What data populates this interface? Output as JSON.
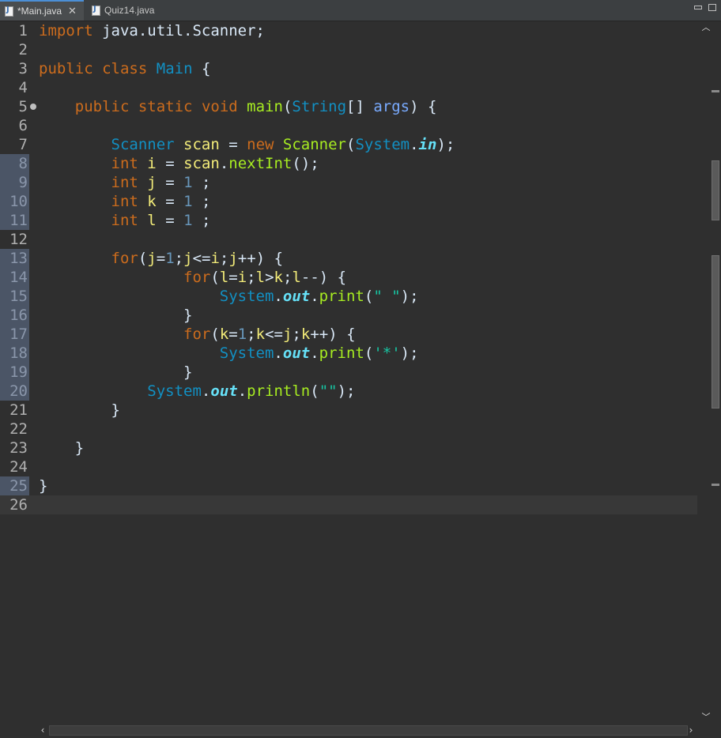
{
  "tabs": [
    {
      "label": "*Main.java",
      "active": true
    },
    {
      "label": "Quiz14.java",
      "active": false
    }
  ],
  "icons": {
    "java_file": "java-file-icon",
    "close": "close-icon",
    "minimize": "minimize-icon",
    "maximize": "maximize-icon"
  },
  "colors": {
    "keyword": "#cc6c1d",
    "type": "#1290c3",
    "method": "#a7ec21",
    "variable": "#f3ec79",
    "number": "#6897bb",
    "string": "#17c6a3",
    "static_field": "#66e1f8",
    "background": "#2f2f2f"
  },
  "lines": [
    {
      "n": "1",
      "mark": false,
      "tokens": [
        [
          "kw",
          "import"
        ],
        [
          "plain",
          " java.util.Scanner;"
        ]
      ]
    },
    {
      "n": "2",
      "mark": false,
      "tokens": []
    },
    {
      "n": "3",
      "mark": false,
      "tokens": [
        [
          "kw",
          "public"
        ],
        [
          "plain",
          " "
        ],
        [
          "kw",
          "class"
        ],
        [
          "plain",
          " "
        ],
        [
          "cls",
          "Main"
        ],
        [
          "plain",
          " {"
        ]
      ]
    },
    {
      "n": "4",
      "mark": false,
      "tokens": []
    },
    {
      "n": "5",
      "mark": false,
      "fold": true,
      "tokens": [
        [
          "plain",
          "    "
        ],
        [
          "kw",
          "public"
        ],
        [
          "plain",
          " "
        ],
        [
          "kw",
          "static"
        ],
        [
          "plain",
          " "
        ],
        [
          "kw",
          "void"
        ],
        [
          "plain",
          " "
        ],
        [
          "fn",
          "main"
        ],
        [
          "plain",
          "("
        ],
        [
          "ty",
          "String"
        ],
        [
          "plain",
          "[] "
        ],
        [
          "arg",
          "args"
        ],
        [
          "plain",
          ") {"
        ]
      ]
    },
    {
      "n": "6",
      "mark": false,
      "tokens": []
    },
    {
      "n": "7",
      "mark": false,
      "tokens": [
        [
          "plain",
          "        "
        ],
        [
          "ty",
          "Scanner"
        ],
        [
          "plain",
          " "
        ],
        [
          "var",
          "scan"
        ],
        [
          "plain",
          " = "
        ],
        [
          "kw",
          "new"
        ],
        [
          "plain",
          " "
        ],
        [
          "fn",
          "Scanner"
        ],
        [
          "plain",
          "("
        ],
        [
          "ty",
          "System"
        ],
        [
          "plain",
          "."
        ],
        [
          "italic",
          "in"
        ],
        [
          "plain",
          ");"
        ]
      ]
    },
    {
      "n": "8",
      "mark": true,
      "tokens": [
        [
          "plain",
          "        "
        ],
        [
          "kw",
          "int"
        ],
        [
          "plain",
          " "
        ],
        [
          "var",
          "i"
        ],
        [
          "plain",
          " = "
        ],
        [
          "var",
          "scan"
        ],
        [
          "plain",
          "."
        ],
        [
          "fn",
          "nextInt"
        ],
        [
          "plain",
          "();"
        ]
      ]
    },
    {
      "n": "9",
      "mark": true,
      "tokens": [
        [
          "plain",
          "        "
        ],
        [
          "kw",
          "int"
        ],
        [
          "plain",
          " "
        ],
        [
          "var",
          "j"
        ],
        [
          "plain",
          " = "
        ],
        [
          "num",
          "1"
        ],
        [
          "plain",
          " ;"
        ]
      ]
    },
    {
      "n": "10",
      "mark": true,
      "tokens": [
        [
          "plain",
          "        "
        ],
        [
          "kw",
          "int"
        ],
        [
          "plain",
          " "
        ],
        [
          "var",
          "k"
        ],
        [
          "plain",
          " = "
        ],
        [
          "num",
          "1"
        ],
        [
          "plain",
          " ;"
        ]
      ]
    },
    {
      "n": "11",
      "mark": true,
      "tokens": [
        [
          "plain",
          "        "
        ],
        [
          "kw",
          "int"
        ],
        [
          "plain",
          " "
        ],
        [
          "var",
          "l"
        ],
        [
          "plain",
          " = "
        ],
        [
          "num",
          "1"
        ],
        [
          "plain",
          " ;"
        ]
      ]
    },
    {
      "n": "12",
      "mark": false,
      "tokens": []
    },
    {
      "n": "13",
      "mark": true,
      "tokens": [
        [
          "plain",
          "        "
        ],
        [
          "kw",
          "for"
        ],
        [
          "plain",
          "("
        ],
        [
          "var",
          "j"
        ],
        [
          "plain",
          "="
        ],
        [
          "num",
          "1"
        ],
        [
          "plain",
          ";"
        ],
        [
          "var",
          "j"
        ],
        [
          "plain",
          "<="
        ],
        [
          "var",
          "i"
        ],
        [
          "plain",
          ";"
        ],
        [
          "var",
          "j"
        ],
        [
          "plain",
          "++) {"
        ]
      ]
    },
    {
      "n": "14",
      "mark": true,
      "tokens": [
        [
          "plain",
          "                "
        ],
        [
          "kw",
          "for"
        ],
        [
          "plain",
          "("
        ],
        [
          "var",
          "l"
        ],
        [
          "plain",
          "="
        ],
        [
          "var",
          "i"
        ],
        [
          "plain",
          ";"
        ],
        [
          "var",
          "l"
        ],
        [
          "plain",
          ">"
        ],
        [
          "var",
          "k"
        ],
        [
          "plain",
          ";"
        ],
        [
          "var",
          "l"
        ],
        [
          "plain",
          "--) {"
        ]
      ]
    },
    {
      "n": "15",
      "mark": true,
      "tokens": [
        [
          "plain",
          "                    "
        ],
        [
          "ty",
          "System"
        ],
        [
          "plain",
          "."
        ],
        [
          "italic",
          "out"
        ],
        [
          "plain",
          "."
        ],
        [
          "fn",
          "print"
        ],
        [
          "plain",
          "("
        ],
        [
          "str",
          "\" \""
        ],
        [
          "plain",
          ");"
        ]
      ]
    },
    {
      "n": "16",
      "mark": true,
      "tokens": [
        [
          "plain",
          "                }"
        ]
      ]
    },
    {
      "n": "17",
      "mark": true,
      "tokens": [
        [
          "plain",
          "                "
        ],
        [
          "kw",
          "for"
        ],
        [
          "plain",
          "("
        ],
        [
          "var",
          "k"
        ],
        [
          "plain",
          "="
        ],
        [
          "num",
          "1"
        ],
        [
          "plain",
          ";"
        ],
        [
          "var",
          "k"
        ],
        [
          "plain",
          "<="
        ],
        [
          "var",
          "j"
        ],
        [
          "plain",
          ";"
        ],
        [
          "var",
          "k"
        ],
        [
          "plain",
          "++) {"
        ]
      ]
    },
    {
      "n": "18",
      "mark": true,
      "tokens": [
        [
          "plain",
          "                    "
        ],
        [
          "ty",
          "System"
        ],
        [
          "plain",
          "."
        ],
        [
          "italic",
          "out"
        ],
        [
          "plain",
          "."
        ],
        [
          "fn",
          "print"
        ],
        [
          "plain",
          "("
        ],
        [
          "str",
          "'*'"
        ],
        [
          "plain",
          ");"
        ]
      ]
    },
    {
      "n": "19",
      "mark": true,
      "tokens": [
        [
          "plain",
          "                }"
        ]
      ]
    },
    {
      "n": "20",
      "mark": true,
      "tokens": [
        [
          "plain",
          "            "
        ],
        [
          "ty",
          "System"
        ],
        [
          "plain",
          "."
        ],
        [
          "italic",
          "out"
        ],
        [
          "plain",
          "."
        ],
        [
          "fn",
          "println"
        ],
        [
          "plain",
          "("
        ],
        [
          "str",
          "\"\""
        ],
        [
          "plain",
          ");"
        ]
      ]
    },
    {
      "n": "21",
      "mark": false,
      "tokens": [
        [
          "plain",
          "        }"
        ]
      ]
    },
    {
      "n": "22",
      "mark": false,
      "tokens": []
    },
    {
      "n": "23",
      "mark": false,
      "tokens": [
        [
          "plain",
          "    }"
        ]
      ]
    },
    {
      "n": "24",
      "mark": false,
      "tokens": []
    },
    {
      "n": "25",
      "mark": true,
      "tokens": [
        [
          "plain",
          "}"
        ]
      ]
    },
    {
      "n": "26",
      "mark": false,
      "current": true,
      "tokens": []
    }
  ]
}
